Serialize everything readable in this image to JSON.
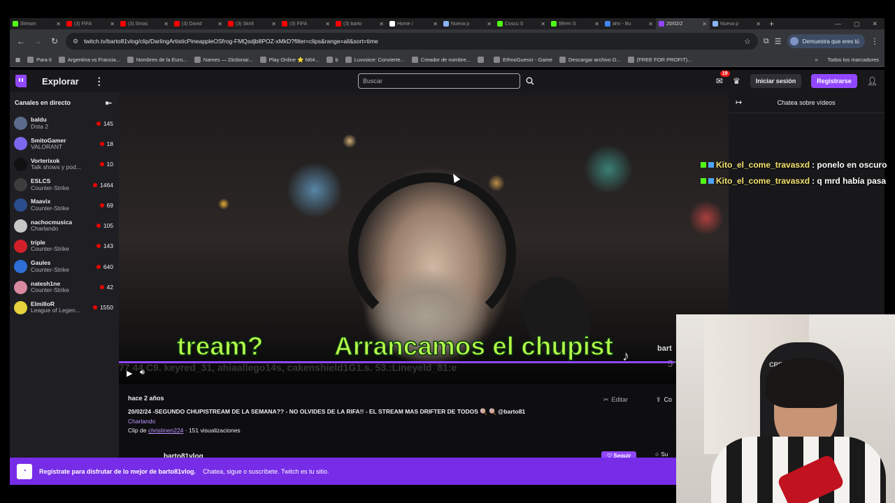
{
  "browser": {
    "tabs": [
      {
        "title": "Stream",
        "color": "#53fc18"
      },
      {
        "title": "(3) FIFA",
        "color": "#ff0000"
      },
      {
        "title": "(3) Smas",
        "color": "#ff0000"
      },
      {
        "title": "(3) David",
        "color": "#ff0000"
      },
      {
        "title": "(3) Skrill",
        "color": "#ff0000"
      },
      {
        "title": "(3) FIFA",
        "color": "#ff0000"
      },
      {
        "title": "(3) barto",
        "color": "#ff0000"
      },
      {
        "title": "Home /",
        "color": "#ffffff"
      },
      {
        "title": "Nueva p",
        "color": "#8ab4f8"
      },
      {
        "title": "Coscu S",
        "color": "#53fc18"
      },
      {
        "title": "99ren S",
        "color": "#53fc18"
      },
      {
        "title": "ahn - Bu",
        "color": "#4285f4"
      },
      {
        "title": "20/02/2",
        "color": "#9147ff"
      },
      {
        "title": "Nueva p",
        "color": "#8ab4f8"
      }
    ],
    "active_tab_index": 12,
    "url": "twitch.tv/barto81vlog/clip/DarlingArtisticPineappleOSfrog-FMQsdjb8POZ-xMkD?filter=clips&range=all&sort=time",
    "profile_button": "Demuestra que eres tú",
    "bookmarks": [
      "Para ti",
      "Argentina vs Francia...",
      "Nombres de la Euro...",
      "Names — Dictionar...",
      "Play Online ⭐ N64...",
      "b",
      "Luvvoice: Convierte...",
      "Creador de nombre...",
      "",
      "EthnoGuessr - Game",
      "Descargar archivo D...",
      "(FREE FOR PROFIT)..."
    ],
    "bookmarks_more": "»",
    "bookmarks_all": "Todos los marcadores"
  },
  "twitch": {
    "header": {
      "explore": "Explorar",
      "search_placeholder": "Buscar",
      "notif_count": "19",
      "login": "Iniciar sesión",
      "signup": "Registrarse"
    },
    "sidebar": {
      "title": "Canales en directo",
      "channels": [
        {
          "name": "baldu",
          "game": "Dota 2",
          "viewers": "145",
          "color": "#5b6b8c"
        },
        {
          "name": "SmitoGamer",
          "game": "VALORANT",
          "viewers": "18",
          "color": "#7b68ee"
        },
        {
          "name": "Vorterixok",
          "game": "Talk shows y pod...",
          "viewers": "10",
          "color": "#111111"
        },
        {
          "name": "ESLCS",
          "game": "Counter-Strike",
          "viewers": "1464",
          "color": "#3d3d3d"
        },
        {
          "name": "Maavix",
          "game": "Counter-Strike",
          "viewers": "69",
          "color": "#2b4d8c"
        },
        {
          "name": "nachocmusica",
          "game": "Charlando",
          "viewers": "105",
          "color": "#c7c7c7"
        },
        {
          "name": "triple",
          "game": "Counter-Strike",
          "viewers": "143",
          "color": "#d2202a"
        },
        {
          "name": "Gaules",
          "game": "Counter-Strike",
          "viewers": "640",
          "color": "#2e6fd6"
        },
        {
          "name": "natesh1ne",
          "game": "Counter-Strike",
          "viewers": "42",
          "color": "#d98aa0"
        },
        {
          "name": "ElmilloR",
          "game": "League of Legen...",
          "viewers": "1550",
          "color": "#e6d23c"
        }
      ]
    },
    "player": {
      "subtitle_left": "tream?",
      "subtitle_right": "Arrancamos el chupist",
      "tiktok_user": "bart",
      "ghost_text": "77 44 C9. keyred_31, ahiaallego14s, cakenshield1G1.s. 53.:Lineyeld_81:e",
      "ghost_num": "5",
      "progress": 0.91
    },
    "chat": {
      "header": "Chatea sobre vídeos"
    },
    "overlay_chat": [
      {
        "user": "Kito_el_come_travasxd",
        "msg": ": ponelo en oscuro"
      },
      {
        "user": "Kito_el_come_travasxd",
        "msg": ": q mrd había pasa"
      }
    ],
    "clip": {
      "ago": "hace 2 años",
      "title": "20/02/24 -SEGUNDO CHUPISTREAM DE LA SEMANA?? - NO OLVIDES DE LA RIFA!! - EL STREAM MAS DRIFTER DE TODOS 🍭 🍭 @barto81",
      "category": "Charlando",
      "clip_by_prefix": "Clip de ",
      "clip_by_user": "christinen224",
      "views": "· 151 visualizaciones",
      "edit": "Editar",
      "share": "Co",
      "channel_name": "barto81vlog",
      "follow": "Seguir",
      "subscribe": "Su"
    },
    "promo": {
      "bold": "Regístrate para disfrutar de lo mejor de barto81vlog.",
      "text": "Chatea, sigue o suscríbete. Twitch es tu sitio."
    }
  },
  "webcam": {
    "chair_label": "CRE-T"
  }
}
